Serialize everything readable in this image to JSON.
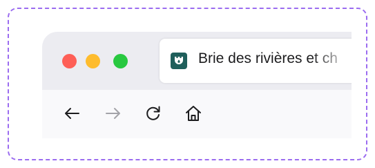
{
  "tab": {
    "title": "Brie des rivières et ch"
  },
  "colors": {
    "frame_dash": "#9b6cf0",
    "tabbar_bg": "#ececf1",
    "toolbar_bg": "#f9f9fb",
    "close": "#fe5f57",
    "minimize": "#febc2e",
    "maximize": "#28c840",
    "favicon_bg": "#1f5f5b"
  },
  "icons": {
    "favicon": "castle-tower-icon",
    "back": "arrow-left-icon",
    "forward": "arrow-right-icon",
    "reload": "reload-icon",
    "home": "home-icon"
  }
}
